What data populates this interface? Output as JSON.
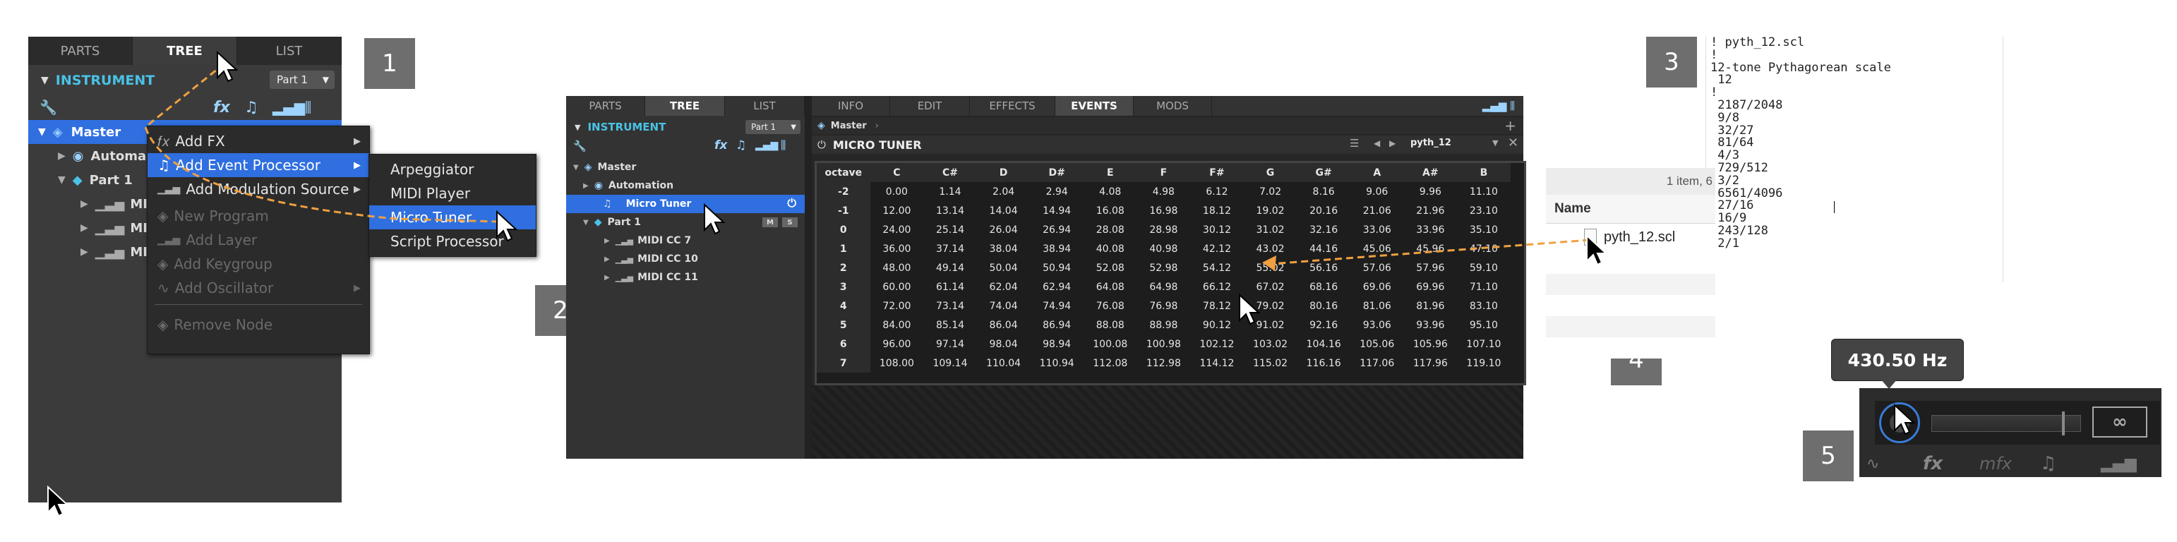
{
  "steps": [
    "1",
    "2",
    "3",
    "4",
    "5"
  ],
  "panel1": {
    "tabs": [
      "PARTS",
      "TREE",
      "LIST"
    ],
    "active_tab": "TREE",
    "section": "INSTRUMENT",
    "part_select": "Part 1",
    "toolbar": {
      "fx": "fx"
    },
    "tree": {
      "master": "Master",
      "automation": "Automa",
      "part1": "Part 1",
      "midi1": "MIDI",
      "midi2": "MIDI",
      "midi3": "MIDI"
    },
    "context_menu": [
      {
        "label": "Add FX",
        "enabled": true,
        "submenu": true
      },
      {
        "label": "Add Event Processor",
        "enabled": true,
        "submenu": true,
        "selected": true
      },
      {
        "label": "Add Modulation Source",
        "enabled": true,
        "submenu": true
      },
      {
        "label": "New Program",
        "enabled": false
      },
      {
        "label": "Add Layer",
        "enabled": false
      },
      {
        "label": "Add Keygroup",
        "enabled": false
      },
      {
        "label": "Add Oscillator",
        "enabled": false,
        "submenu": true
      },
      {
        "label": "Remove Node",
        "enabled": false
      }
    ],
    "submenu": [
      {
        "label": "Arpeggiator"
      },
      {
        "label": "MIDI Player"
      },
      {
        "label": "Micro Tuner",
        "selected": true
      },
      {
        "label": "Script Processor"
      }
    ]
  },
  "panel2": {
    "left_tabs": [
      "PARTS",
      "TREE",
      "LIST"
    ],
    "active_left_tab": "TREE",
    "section": "INSTRUMENT",
    "part_select": "Part 1",
    "fx": "fx",
    "tree": {
      "master": "Master",
      "automation": "Automation",
      "micro_tuner": "Micro Tuner",
      "part1": "Part 1",
      "badge_m": "M",
      "badge_s": "S",
      "cc7": "MIDI CC 7",
      "cc10": "MIDI CC 10",
      "cc11": "MIDI CC 11"
    },
    "right_tabs": [
      "INFO",
      "EDIT",
      "EFFECTS",
      "EVENTS",
      "MODS"
    ],
    "active_right_tab": "EVENTS",
    "breadcrumb": "Master",
    "plus": "+",
    "module_title": "MICRO TUNER",
    "preset": "pyth_12",
    "table": {
      "header": [
        "octave",
        "C",
        "C#",
        "D",
        "D#",
        "E",
        "F",
        "F#",
        "G",
        "G#",
        "A",
        "A#",
        "B"
      ],
      "rows": [
        [
          "-2",
          "0.00",
          "1.14",
          "2.04",
          "2.94",
          "4.08",
          "4.98",
          "6.12",
          "7.02",
          "8.16",
          "9.06",
          "9.96",
          "11.10"
        ],
        [
          "-1",
          "12.00",
          "13.14",
          "14.04",
          "14.94",
          "16.08",
          "16.98",
          "18.12",
          "19.02",
          "20.16",
          "21.06",
          "21.96",
          "23.10"
        ],
        [
          "0",
          "24.00",
          "25.14",
          "26.04",
          "26.94",
          "28.08",
          "28.98",
          "30.12",
          "31.02",
          "32.16",
          "33.06",
          "33.96",
          "35.10"
        ],
        [
          "1",
          "36.00",
          "37.14",
          "38.04",
          "38.94",
          "40.08",
          "40.98",
          "42.12",
          "43.02",
          "44.16",
          "45.06",
          "45.96",
          "47.10"
        ],
        [
          "2",
          "48.00",
          "49.14",
          "50.04",
          "50.94",
          "52.08",
          "52.98",
          "54.12",
          "55.02",
          "56.16",
          "57.06",
          "57.96",
          "59.10"
        ],
        [
          "3",
          "60.00",
          "61.14",
          "62.04",
          "62.94",
          "64.08",
          "64.98",
          "66.12",
          "67.02",
          "68.16",
          "69.06",
          "69.96",
          "71.10"
        ],
        [
          "4",
          "72.00",
          "73.14",
          "74.04",
          "74.94",
          "76.08",
          "76.98",
          "78.12",
          "79.02",
          "80.16",
          "81.06",
          "81.96",
          "83.10"
        ],
        [
          "5",
          "84.00",
          "85.14",
          "86.04",
          "86.94",
          "88.08",
          "88.98",
          "90.12",
          "91.02",
          "92.16",
          "93.06",
          "93.96",
          "95.10"
        ],
        [
          "6",
          "96.00",
          "97.14",
          "98.04",
          "98.94",
          "100.08",
          "100.98",
          "102.12",
          "103.02",
          "104.16",
          "105.06",
          "105.96",
          "107.10"
        ],
        [
          "7",
          "108.00",
          "109.14",
          "110.04",
          "110.94",
          "112.08",
          "112.98",
          "114.12",
          "115.02",
          "116.16",
          "117.06",
          "117.96",
          "119.10"
        ]
      ]
    }
  },
  "panel3": {
    "lines": [
      "! pyth_12.scl",
      "!",
      "12-tone Pythagorean scale",
      " 12",
      "!",
      " 2187/2048",
      " 9/8",
      " 32/27",
      " 81/64",
      " 4/3",
      " 729/512",
      " 3/2",
      " 6561/4096",
      " 27/16",
      " 16/9",
      " 243/128",
      " 2/1"
    ]
  },
  "panel4": {
    "status": "1 item, 6",
    "column": "Name",
    "file": "pyth_12.scl"
  },
  "panel5": {
    "tooltip": "430.50 Hz",
    "tabs": [
      "",
      "fx",
      "mfx",
      "",
      ""
    ]
  },
  "colors": {
    "accent_blue": "#2f6fe0",
    "instrument_cyan": "#49c2e6",
    "drag_line": "#f0a040",
    "panel_bg": "#3b3b3b",
    "step_badge": "#6e6e6e"
  }
}
